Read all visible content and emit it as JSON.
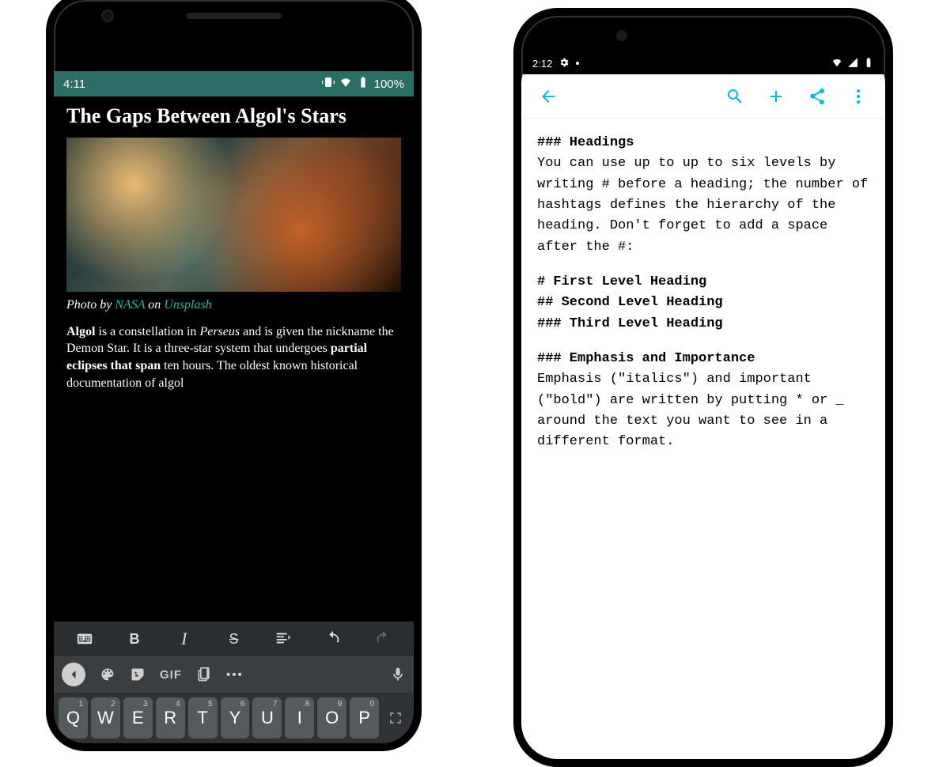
{
  "left": {
    "status": {
      "time": "4:11",
      "battery": "100%"
    },
    "article": {
      "title": "The Gaps Between Algol's Stars",
      "caption_prefix": "Photo by ",
      "caption_link1": "NASA",
      "caption_mid": " on ",
      "caption_link2": "Unsplash",
      "body_b1": "Algol",
      "body_t1": " is a constellation in ",
      "body_i1": "Perseus",
      "body_t2": " and is given the nickname the Demon Star. It is a three-star system that undergoes ",
      "body_b2": "partial eclipses that span",
      "body_t3": " ten hours. The oldest known historical documentation of algol"
    },
    "format": {
      "kb_toggle": "keyboard",
      "bold": "B",
      "italic": "I",
      "strike": "S",
      "quote": "quote",
      "undo": "undo",
      "redo": "redo"
    },
    "kb": {
      "gif": "GIF",
      "row1": [
        "Q",
        "W",
        "E",
        "R",
        "T",
        "Y",
        "U",
        "I",
        "O",
        "P"
      ],
      "sups": [
        "1",
        "2",
        "3",
        "4",
        "5",
        "6",
        "7",
        "8",
        "9",
        "0"
      ]
    }
  },
  "right": {
    "status": {
      "time": "2:12"
    },
    "md": {
      "h1": "### Headings",
      "p1": "You can use up to up to six levels by writing # before a heading; the number of hashtags defines the hierarchy of the heading. Don't forget to add a space after the #:",
      "ex1": "# First Level Heading",
      "ex2": "## Second Level Heading",
      "ex3": "### Third Level Heading",
      "h2": "### Emphasis and Importance",
      "p2": "Emphasis (\"italics\") and important (\"bold\") are written by putting * or _ around the text you want to see in a different format."
    }
  }
}
